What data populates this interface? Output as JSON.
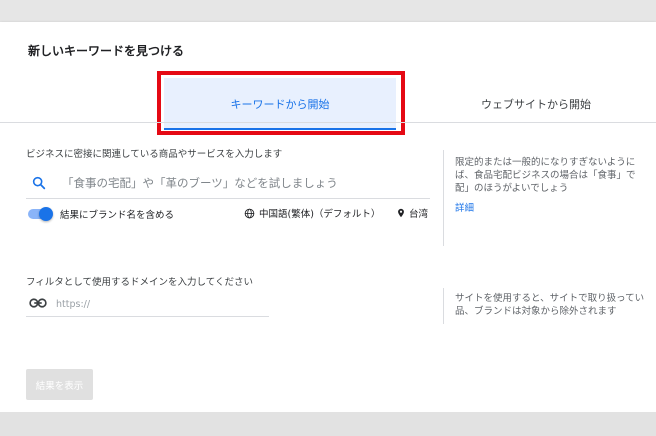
{
  "dialog": {
    "title": "新しいキーワードを見つける"
  },
  "tabs": [
    {
      "label": "キーワードから開始",
      "active": true
    },
    {
      "label": "ウェブサイトから開始",
      "active": false
    }
  ],
  "keywords": {
    "section_label": "ビジネスに密接に関連している商品やサービスを入力します",
    "placeholder": "「食事の宅配」や「革のブーツ」などを試しましょう",
    "include_brand": {
      "label": "結果にブランド名を含める",
      "enabled": true
    },
    "language": "中国語(繁体)（デフォルト）",
    "location": "台湾",
    "help_text": "限定的または一般的になりすぎないように\nば、食品宅配ビジネスの場合は「食事」で\n配」のほうがよいでしょう",
    "details_link": "詳細"
  },
  "domain": {
    "section_label": "フィルタとして使用するドメインを入力してください",
    "placeholder": "https://",
    "help_text": "サイトを使用すると、サイトで取り扱ってい\n品、ブランドは対象から除外されます"
  },
  "actions": {
    "show_results_label": "結果を表示"
  },
  "colors": {
    "accent": "#1a73e8",
    "active_tab_bg": "#e8f0fe",
    "highlight_box": "#e50914"
  },
  "icons": [
    "search-icon",
    "globe-icon",
    "location-pin-icon",
    "link-icon"
  ]
}
